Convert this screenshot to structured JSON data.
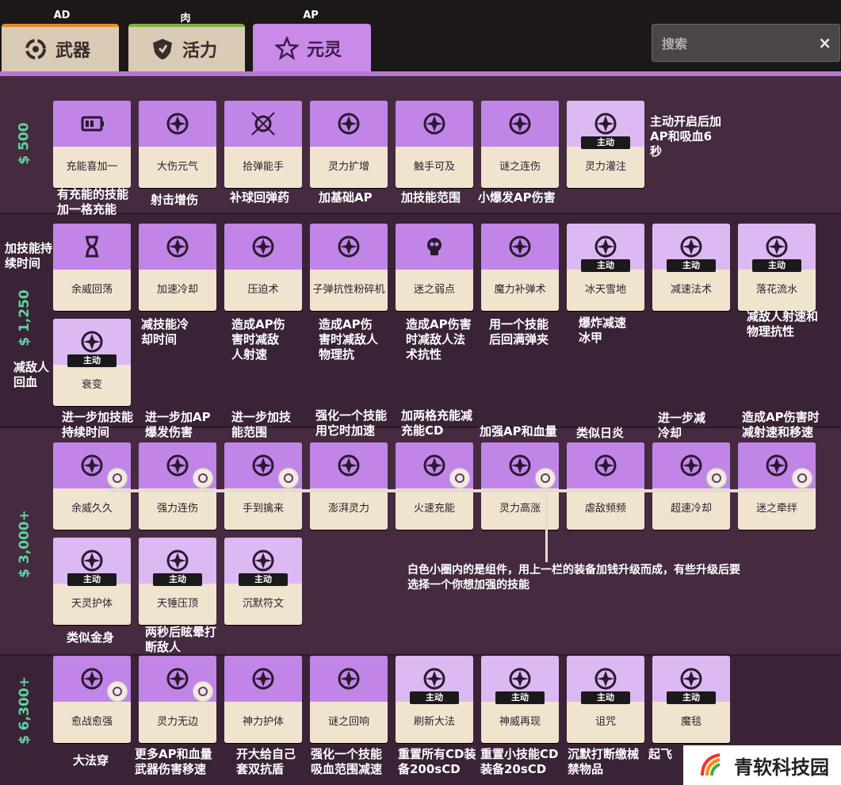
{
  "tabs": [
    {
      "label": "武器",
      "tag": "AD",
      "icon": "weapon-ring-icon"
    },
    {
      "label": "活力",
      "tag": "肉",
      "icon": "vitality-shield-icon"
    },
    {
      "label": "元灵",
      "tag": "AP",
      "icon": "spirit-star-icon"
    }
  ],
  "search": {
    "placeholder": "搜索",
    "clear": "×"
  },
  "prices": [
    "$ 500",
    "$ 1,250",
    "$ 3,000+",
    "$ 6,300+"
  ],
  "tier500": [
    {
      "name": "充能喜加一",
      "icon": "battery-icon",
      "note": "有充能的技能加一格充能"
    },
    {
      "name": "大伤元气",
      "icon": "fist-burst-icon",
      "note": "射击增伤"
    },
    {
      "name": "拾弹能手",
      "icon": "crosshair-icon",
      "note": "补球回弹药"
    },
    {
      "name": "灵力扩增",
      "icon": "heart-bolt-icon",
      "note": "加基础AP"
    },
    {
      "name": "触手可及",
      "icon": "radio-wave-icon",
      "note": "加技能范围"
    },
    {
      "name": "谜之连伤",
      "icon": "star-burst-icon",
      "note": "小爆发AP伤害"
    },
    {
      "name": "灵力灌注",
      "icon": "crown-icon",
      "active": "主动",
      "note": "主动开启后加AP和吸血6秒"
    }
  ],
  "tier1250": [
    {
      "name": "余威回荡",
      "icon": "hourglass-icon",
      "note": "加技能持续时间"
    },
    {
      "name": "加速冷却",
      "icon": "cooldown-icon",
      "note": "减技能冷却时间"
    },
    {
      "name": "压迫术",
      "icon": "wind-lines-icon",
      "note": "造成AP伤害时减敌人射速"
    },
    {
      "name": "子弹抗性粉碎机",
      "icon": "shield-break-icon",
      "note": "造成AP伤害时减敌人物理抗"
    },
    {
      "name": "迷之弱点",
      "icon": "skull-icon",
      "note": "造成AP伤害时减敌人法术抗性"
    },
    {
      "name": "魔力补弹术",
      "icon": "bullets-icon",
      "note": "用一个技能后回满弹夹"
    },
    {
      "name": "冰天雪地",
      "icon": "ice-figure-icon",
      "active": "主动",
      "note": "爆炸减速冰甲"
    },
    {
      "name": "减速法术",
      "icon": "slow-figure-icon",
      "active": "主动",
      "note": ""
    },
    {
      "name": "落花流水",
      "icon": "fall-figure-icon",
      "active": "主动",
      "note": "减敌人射速和物理抗性"
    },
    {
      "name": "衰变",
      "icon": "decay-heart-icon",
      "active": "主动",
      "note": "减敌人回血"
    }
  ],
  "tier3000": [
    {
      "name": "余威久久",
      "icon": "hourglass-ornate-icon",
      "note": "进一步加技能持续时间"
    },
    {
      "name": "强力连伤",
      "icon": "swirl-burst-icon",
      "note": "进一步加AP爆发伤害"
    },
    {
      "name": "手到擒来",
      "icon": "reach-hand-icon",
      "note": "进一步加技能范围"
    },
    {
      "name": "澎湃灵力",
      "icon": "spirit-face-icon",
      "note": "强化一个技能用它时加速"
    },
    {
      "name": "火速充能",
      "icon": "charge-battery-icon",
      "note": "加两格充能减充能CD"
    },
    {
      "name": "灵力高涨",
      "icon": "vortex-icon",
      "note": "加强AP和血量"
    },
    {
      "name": "虐敌频频",
      "icon": "heart-ring-icon",
      "note": "类似日炎"
    },
    {
      "name": "超速冷却",
      "icon": "spin-cooldown-icon",
      "note": "进一步减冷却"
    },
    {
      "name": "迷之牵绊",
      "icon": "bind-figure-icon",
      "note": "造成AP伤害时减射速和移速"
    },
    {
      "name": "天灵护体",
      "icon": "aura-figure-icon",
      "active": "主动",
      "note": "类似金身"
    },
    {
      "name": "天锤压顶",
      "icon": "hammer-icon",
      "active": "主动",
      "note": "两秒后眩晕打断敌人"
    },
    {
      "name": "沉默符文",
      "icon": "rune-icon",
      "active": "主动",
      "note": ""
    }
  ],
  "tier6300": [
    {
      "name": "愈战愈强",
      "icon": "skull-frame-icon",
      "note": "大法穿"
    },
    {
      "name": "灵力无边",
      "icon": "spirit-bloom-icon",
      "note": "更多AP和血量武器伤害移速"
    },
    {
      "name": "神力护体",
      "icon": "halo-icon",
      "note": "开大给自己套双抗盾"
    },
    {
      "name": "谜之回响",
      "icon": "echo-bolt-icon",
      "note": "强化一个技能吸血范围减速"
    },
    {
      "name": "刷新大法",
      "icon": "refresh-icon",
      "active": "主动",
      "note": "重置所有CD装备200sCD"
    },
    {
      "name": "神威再现",
      "icon": "helmet-icon",
      "active": "主动",
      "note": "重置小技能CD装备20sCD"
    },
    {
      "name": "诅咒",
      "icon": "totem-icon",
      "active": "主动",
      "note": "沉默打断缴械禁物品"
    },
    {
      "name": "魔毯",
      "icon": "skate-figure-icon",
      "active": "主动",
      "note": "起飞"
    }
  ],
  "annotation": "白色小圈内的是组件，用上一栏的装备加钱升级而成，有些升级后要选择一个你想加强的技能",
  "watermark": "青软科技园"
}
